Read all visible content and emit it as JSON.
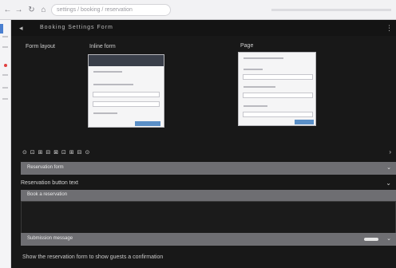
{
  "browser": {
    "address": "settings / booking / reservation",
    "nav_icons": [
      "back-icon",
      "forward-icon",
      "reload-icon"
    ]
  },
  "topbar": {
    "back_glyph": "◂",
    "breadcrumb": "Booking  Settings  Form",
    "more_glyph": "⋮"
  },
  "preview": {
    "left_label": "Form layout",
    "mid_label": "Inline form",
    "right_label": "Page"
  },
  "options": {
    "icons_line": "⊙  ⊡  ⊞  ⊟  ⊠  ⊡  ⊞  ⊟  ⊙",
    "more_glyph": "›",
    "band1_text": "Reservation form",
    "band1_end": "⌄",
    "section2_label": "Reservation button text",
    "section2_end": "⌄",
    "band2_text": "Book a reservation",
    "band3_text": "Submission message",
    "band3_end": "⌄"
  },
  "footer": {
    "text": "Show the reservation form to show guests a confirmation"
  },
  "colors": {
    "accent": "#5a8fc7",
    "band": "#6e6e72",
    "dark": "#181818"
  }
}
